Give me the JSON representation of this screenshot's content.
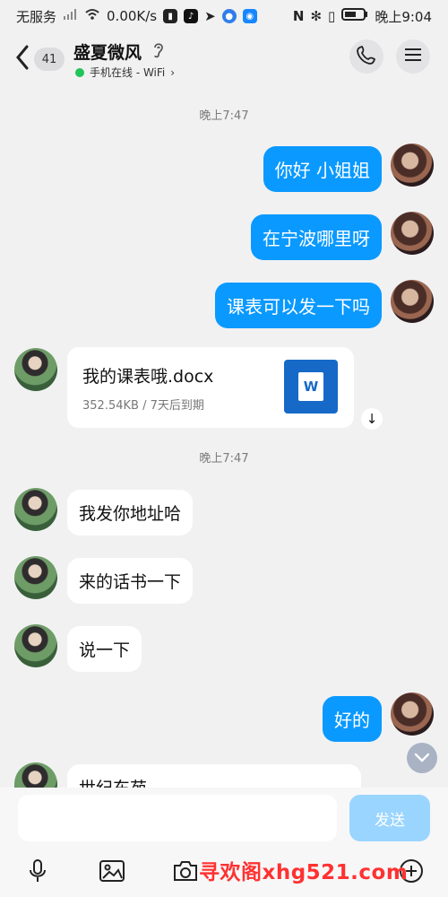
{
  "status_bar": {
    "carrier": "无服务",
    "speed": "0.00K/s",
    "time": "晚上9:04"
  },
  "chat": {
    "unread_count": "41",
    "contact_name": "盛夏微风",
    "online_status": "手机在线 - WiFi",
    "messages": [
      {
        "type": "time",
        "text": "晚上7:47"
      },
      {
        "type": "outgoing",
        "text": "你好 小姐姐"
      },
      {
        "type": "outgoing",
        "text": "在宁波哪里呀"
      },
      {
        "type": "outgoing",
        "text": "课表可以发一下吗"
      },
      {
        "type": "file",
        "name": "我的课表哦.docx",
        "meta": "352.54KB / 7天后到期",
        "icon": "W"
      },
      {
        "type": "time",
        "text": "晚上7:47"
      },
      {
        "type": "incoming",
        "text": "我发你地址哈"
      },
      {
        "type": "incoming",
        "text": "来的话书一下"
      },
      {
        "type": "incoming",
        "text": "说一下"
      },
      {
        "type": "outgoing",
        "text": "好的"
      },
      {
        "type": "incoming",
        "text": "世纪东苑"
      }
    ]
  },
  "composer": {
    "placeholder": "",
    "send_label": "发送"
  },
  "watermark": "寻欢阁xhg521.com",
  "colors": {
    "accent": "#0a99ff",
    "send_disabled": "#9ad5ff",
    "online": "#21c45a"
  },
  "icons": {
    "back": "chevron-left-icon",
    "call": "phone-icon",
    "menu": "menu-icon",
    "voice": "microphone-icon",
    "image": "image-icon",
    "camera": "camera-icon",
    "more": "plus-circle-icon",
    "scroll": "chevron-down-icon"
  }
}
